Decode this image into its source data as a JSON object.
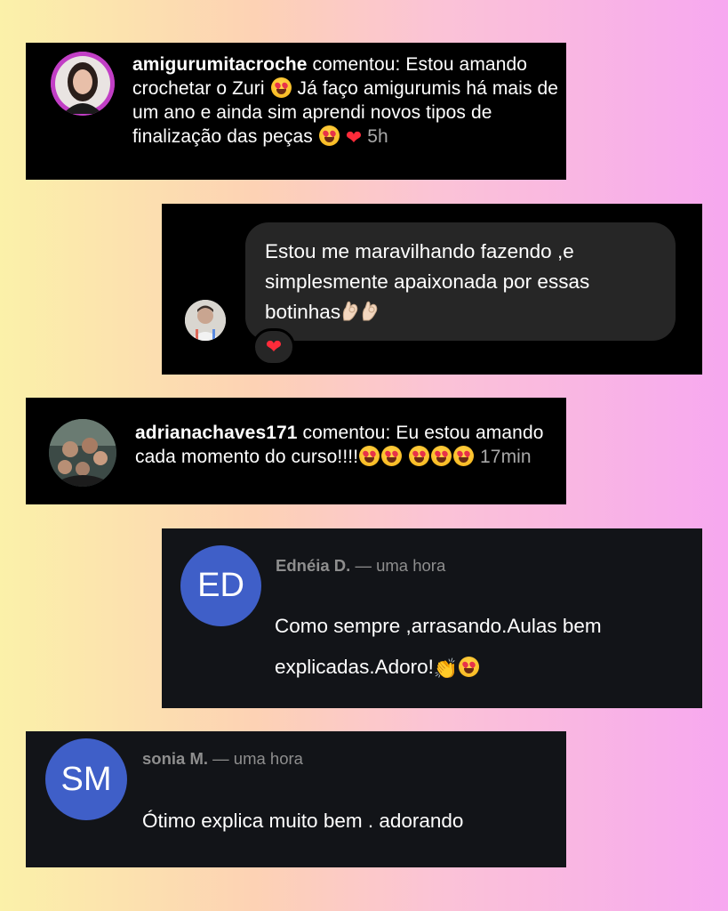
{
  "card1": {
    "username": "amigurumitacroche",
    "text_a": " comentou: Estou amando crochetar o Zuri ",
    "text_b": " Já faço amigurumis há mais de um ano e ainda sim aprendi novos tipos de finalização das peças ",
    "time": "5h"
  },
  "card2": {
    "message": "Estou me maravilhando fazendo ,e simplesmente apaixonada por essas botinhas",
    "reaction": "❤"
  },
  "card3": {
    "username": "adrianachaves171",
    "text": " comentou: Eu estou amando cada momento do curso!!!!",
    "time": "17min"
  },
  "card4": {
    "initials": "ED",
    "name": "Ednéia D.",
    "when": " — uma hora",
    "comment": "Como sempre ,arrasando.Aulas bem explicadas.Adoro!"
  },
  "card5": {
    "initials": "SM",
    "name": "sonia M.",
    "when": " — uma hora",
    "comment": "Ótimo explica muito bem . adorando"
  },
  "colors": {
    "avatar_blue": "#3f5fc8",
    "heart": "#ff2b3a",
    "bubble": "#262626"
  }
}
